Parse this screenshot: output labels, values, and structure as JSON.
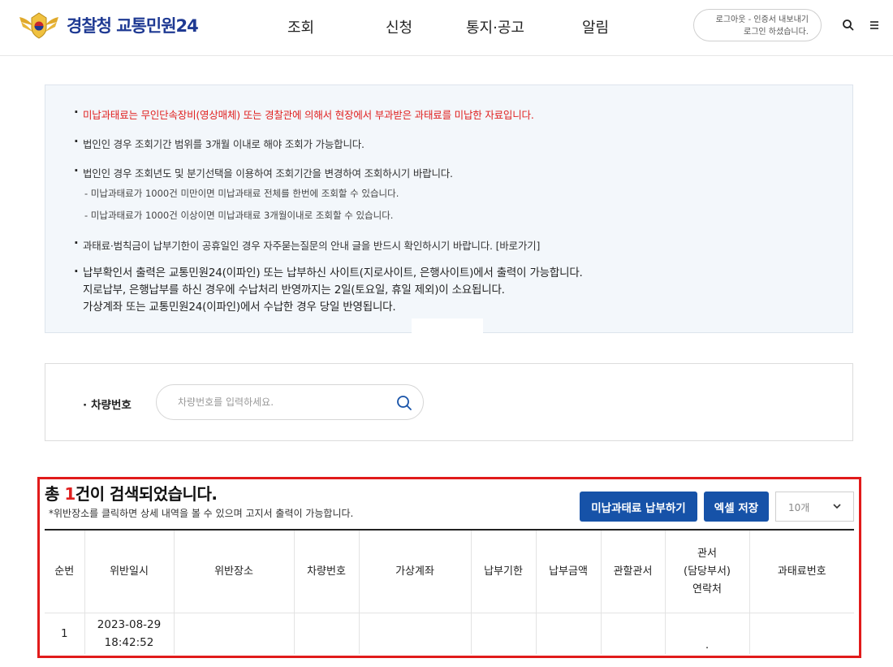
{
  "header": {
    "logo_text": "경찰청 교통민원24",
    "nav": [
      "조회",
      "신청",
      "통지·공고",
      "알림"
    ],
    "login_line1": "로그아웃 - 인증서 내보내기",
    "login_line2": "로그인 하셨습니다."
  },
  "notice": {
    "items": [
      "미납과태료는 무인단속장비(영상매체) 또는 경찰관에 의해서 현장에서 부과받은 과태료를 미납한 자료입니다.",
      "법인인 경우 조회기간 범위를 3개월 이내로 해야 조회가 가능합니다.",
      "법인인 경우 조회년도 및 분기선택을 이용하여 조회기간을 변경하여 조회하시기 바랍니다.",
      "과태료·범칙금이 납부기한이 공휴일인 경우 자주묻는질문의 안내 글을 반드시 확인하시기 바랍니다. [바로가기]"
    ],
    "subitems": [
      "- 미납과태료가 1000건 미만이면 미납과태료 전체를 한번에 조회할 수 있습니다.",
      "- 미납과태료가 1000건 이상이면 미납과태료 3개월이내로 조회할 수 있습니다."
    ],
    "payment_lines": [
      "납부확인서 출력은 교통민원24(이파인) 또는 납부하신 사이트(지로사이트, 은행사이트)에서 출력이 가능합니다.",
      "지로납부, 은행납부를 하신 경우에 수납처리 반영까지는 2일(토요일, 휴일 제외)이 소요됩니다.",
      "가상계좌 또는 교통민원24(이파인)에서 수납한 경우 당일 반영됩니다."
    ]
  },
  "search": {
    "label": "차량번호",
    "placeholder": "차량번호를 입력하세요."
  },
  "results": {
    "title_prefix": "총 ",
    "count": "1",
    "title_suffix": "건이 검색되었습니다.",
    "subtitle": "*위반장소를 클릭하면 상세 내역을 볼 수 있으며 고지서 출력이 가능합니다.",
    "pay_button": "미납과태료 납부하기",
    "excel_button": "엑셀 저장",
    "page_size": "10개",
    "columns": [
      "순번",
      "위반일시",
      "위반장소",
      "차량번호",
      "가상계좌",
      "납부기한",
      "납부금액",
      "관할관서",
      "관서\n(담당부서)\n연락처",
      "과태료번호"
    ],
    "rows": [
      {
        "no": "1",
        "date": "2023-08-29",
        "time": "18:42:52",
        "place": "",
        "car": "",
        "account": "",
        "due": "",
        "amount": "",
        "office": "",
        "contact": ".",
        "fine_no": ""
      }
    ]
  },
  "colors": {
    "brand_navy": "#1f3a93",
    "button_blue": "#1652a8",
    "alert_red": "#e0201f",
    "highlight_frame": "#e11b1b"
  }
}
